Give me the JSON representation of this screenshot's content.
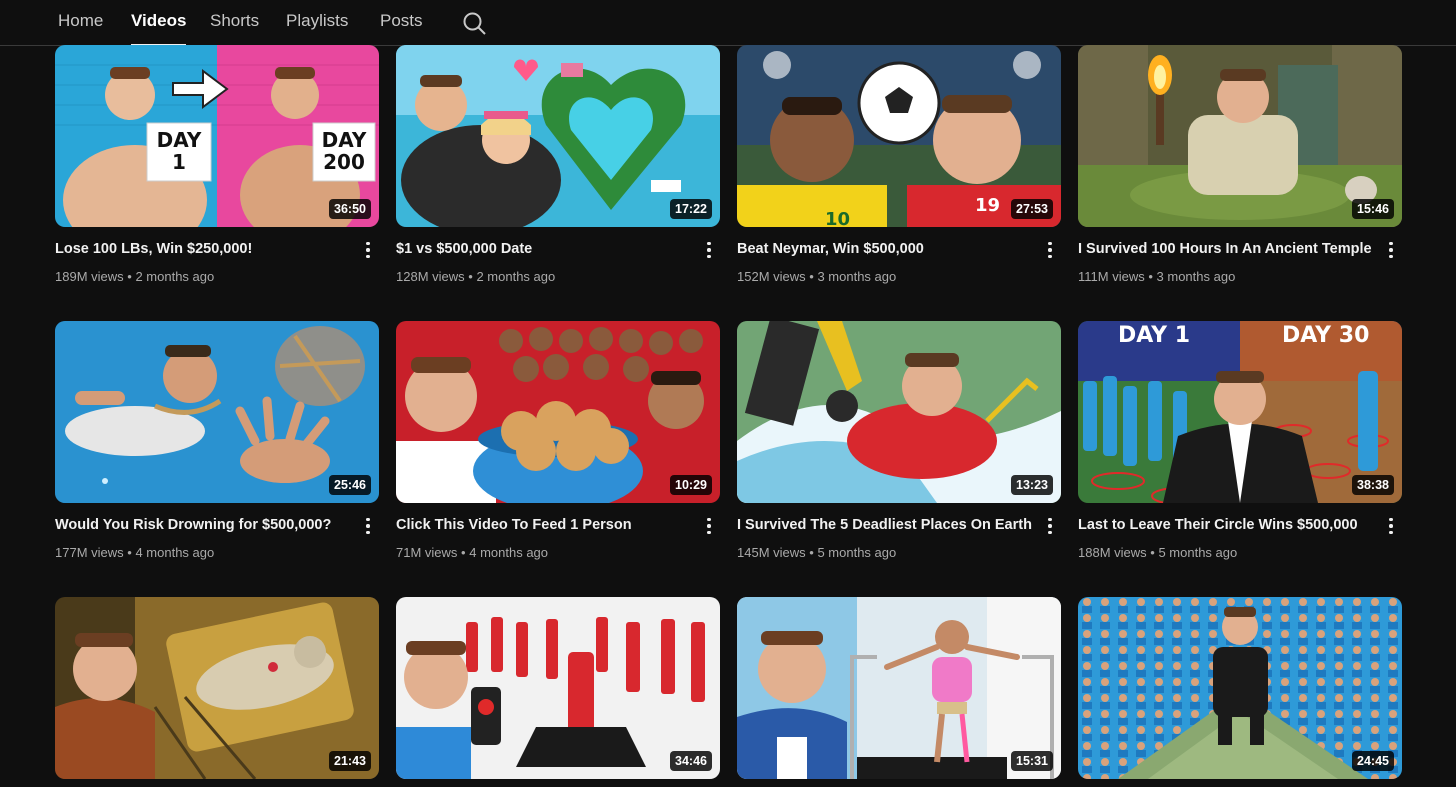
{
  "tabs": [
    {
      "label": "Home",
      "active": false
    },
    {
      "label": "Videos",
      "active": true
    },
    {
      "label": "Shorts",
      "active": false
    },
    {
      "label": "Playlists",
      "active": false
    },
    {
      "label": "Posts",
      "active": false
    }
  ],
  "search": {
    "icon": "search-icon"
  },
  "videos": [
    {
      "title": "Lose 100 LBs, Win $250,000!",
      "views": "189M views",
      "age": "2 months ago",
      "duration": "36:50",
      "thumb_text": [
        "DAY 1",
        "DAY 200"
      ]
    },
    {
      "title": "$1 vs $500,000 Date",
      "views": "128M views",
      "age": "2 months ago",
      "duration": "17:22"
    },
    {
      "title": "Beat Neymar, Win $500,000",
      "views": "152M views",
      "age": "3 months ago",
      "duration": "27:53",
      "thumb_text": [
        "10",
        "19"
      ]
    },
    {
      "title": "I Survived 100 Hours In An Ancient Temple",
      "views": "111M views",
      "age": "3 months ago",
      "duration": "15:46"
    },
    {
      "title": "Would You Risk Drowning for $500,000?",
      "views": "177M views",
      "age": "4 months ago",
      "duration": "25:46"
    },
    {
      "title": "Click This Video To Feed 1 Person",
      "views": "71M views",
      "age": "4 months ago",
      "duration": "10:29"
    },
    {
      "title": "I Survived The 5 Deadliest Places On Earth",
      "views": "145M views",
      "age": "5 months ago",
      "duration": "13:23"
    },
    {
      "title": "Last to Leave Their Circle Wins $500,000",
      "views": "188M views",
      "age": "5 months ago",
      "duration": "38:38",
      "thumb_text": [
        "DAY 1",
        "DAY 30"
      ]
    },
    {
      "duration": "21:43"
    },
    {
      "duration": "34:46"
    },
    {
      "duration": "15:31"
    },
    {
      "duration": "24:45"
    }
  ],
  "separator": "•",
  "colors": {
    "background": "#0f0f0f",
    "text": "#f1f1f1",
    "secondary_text": "#aaaaaa"
  }
}
